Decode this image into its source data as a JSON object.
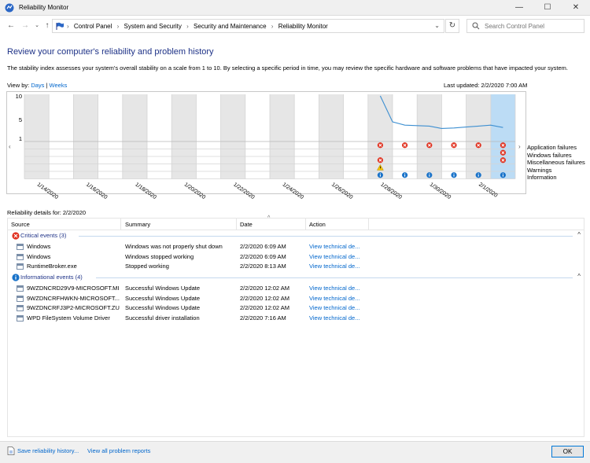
{
  "window": {
    "title": "Reliability Monitor",
    "minimize": "—",
    "maximize": "☐",
    "close": "✕"
  },
  "address": {
    "crumbs": [
      "Control Panel",
      "System and Security",
      "Security and Maintenance",
      "Reliability Monitor"
    ],
    "search_placeholder": "Search Control Panel"
  },
  "heading": "Review your computer's reliability and problem history",
  "description": "The stability index assesses your system's overall stability on a scale from 1 to 10. By selecting a specific period in time, you may review the specific hardware and software problems that have impacted your system.",
  "view_by": {
    "label": "View by:",
    "days": "Days",
    "divider": "|",
    "weeks": "Weeks"
  },
  "last_updated": "Last updated: 2/2/2020 7:00 AM",
  "chart_data": {
    "type": "line",
    "y_ticks": [
      "10",
      "5",
      "1"
    ],
    "ylim": [
      1,
      10
    ],
    "date_labels": [
      "1/14/2020",
      "1/16/2020",
      "1/18/2020",
      "1/20/2020",
      "1/22/2020",
      "1/24/2020",
      "1/26/2020",
      "1/28/2020",
      "1/30/2020",
      "2/1/2020"
    ],
    "columns": 20,
    "selected_column": 19,
    "stability": [
      {
        "col": 14.5,
        "v": 10
      },
      {
        "col": 15,
        "v": 4.5
      },
      {
        "col": 15.5,
        "v": 3.8
      },
      {
        "col": 16,
        "v": 3.7
      },
      {
        "col": 16.5,
        "v": 3.6
      },
      {
        "col": 17,
        "v": 3.1
      },
      {
        "col": 17.5,
        "v": 3.2
      },
      {
        "col": 18,
        "v": 3.4
      },
      {
        "col": 18.5,
        "v": 3.6
      },
      {
        "col": 19,
        "v": 3.8
      },
      {
        "col": 19.5,
        "v": 3.3
      }
    ],
    "rows": [
      "Application failures",
      "Windows failures",
      "Miscellaneous failures",
      "Warnings",
      "Information"
    ],
    "markers": [
      {
        "col": 15,
        "row": 0,
        "kind": "error"
      },
      {
        "col": 16,
        "row": 0,
        "kind": "error"
      },
      {
        "col": 17,
        "row": 0,
        "kind": "error"
      },
      {
        "col": 18,
        "row": 0,
        "kind": "error"
      },
      {
        "col": 19,
        "row": 0,
        "kind": "error"
      },
      {
        "col": 20,
        "row": 0,
        "kind": "error"
      },
      {
        "col": 20,
        "row": 1,
        "kind": "error"
      },
      {
        "col": 15,
        "row": 2,
        "kind": "error"
      },
      {
        "col": 20,
        "row": 2,
        "kind": "error"
      },
      {
        "col": 15,
        "row": 3,
        "kind": "warning"
      },
      {
        "col": 15,
        "row": 4,
        "kind": "info"
      },
      {
        "col": 16,
        "row": 4,
        "kind": "info"
      },
      {
        "col": 17,
        "row": 4,
        "kind": "info"
      },
      {
        "col": 18,
        "row": 4,
        "kind": "info"
      },
      {
        "col": 19,
        "row": 4,
        "kind": "info"
      },
      {
        "col": 20,
        "row": 4,
        "kind": "info"
      }
    ]
  },
  "details_label": "Reliability details for: 2/2/2020",
  "table": {
    "columns": [
      "Source",
      "Summary",
      "Date",
      "Action"
    ],
    "critical_label": "Critical events (3)",
    "info_label": "Informational events (4)",
    "critical": [
      {
        "source": "Windows",
        "summary": "Windows was not properly shut down",
        "date": "2/2/2020 6:09 AM",
        "action": "View technical de..."
      },
      {
        "source": "Windows",
        "summary": "Windows stopped working",
        "date": "2/2/2020 6:09 AM",
        "action": "View technical de..."
      },
      {
        "source": "RuntimeBroker.exe",
        "summary": "Stopped working",
        "date": "2/2/2020 8:13 AM",
        "action": "View technical de..."
      }
    ],
    "informational": [
      {
        "source": "9WZDNCRD29V9-MICROSOFT.MI...",
        "summary": "Successful Windows Update",
        "date": "2/2/2020 12:02 AM",
        "action": "View technical de..."
      },
      {
        "source": "9WZDNCRFHWKN-MICROSOFT....",
        "summary": "Successful Windows Update",
        "date": "2/2/2020 12:02 AM",
        "action": "View technical de..."
      },
      {
        "source": "9WZDNCRFJ3P2-MICROSOFT.ZU...",
        "summary": "Successful Windows Update",
        "date": "2/2/2020 12:02 AM",
        "action": "View technical de..."
      },
      {
        "source": "WPD FileSystem Volume Driver",
        "summary": "Successful driver installation",
        "date": "2/2/2020 7:16 AM",
        "action": "View technical de..."
      }
    ]
  },
  "footer": {
    "save_label": "Save reliability history...",
    "view_all_label": "View all problem reports",
    "ok_label": "OK"
  },
  "colors": {
    "accent": "#0078d7",
    "heading": "#1e3287",
    "link": "#0066cc",
    "line": "#3d8fd1",
    "selected_col": "#bcdcf5",
    "error": "#e0301e",
    "warning": "#f5c400",
    "info": "#1a73c9"
  }
}
